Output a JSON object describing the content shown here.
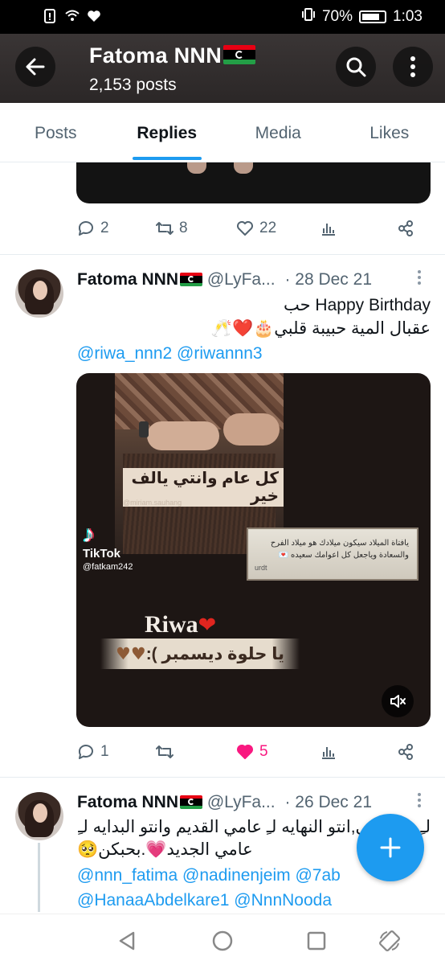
{
  "status_bar": {
    "battery": "70%",
    "time": "1:03"
  },
  "header": {
    "name": "Fatoma NNN",
    "posts": "2,153 posts"
  },
  "tabs": [
    {
      "label": "Posts"
    },
    {
      "label": "Replies",
      "active": true
    },
    {
      "label": "Media"
    },
    {
      "label": "Likes"
    }
  ],
  "tweet1": {
    "replies": "2",
    "retweets": "8",
    "likes": "22"
  },
  "tweet2": {
    "name": "Fatoma NNN",
    "handle": "@LyFa...",
    "date": "· 28 Dec 21",
    "line1": "Happy Birthday حب",
    "line2": "عقبال المية حبيبة قلبي🎂❤️🥂",
    "mentions": "@riwa_nnn2 @riwannn3",
    "media": {
      "caption_top": "كل عام وانتي يالف خير",
      "caption_small": "@miriam.sauhang",
      "note_text": "يافتاة الميلاد سيكون ميلادك هو ميلاد الفرح والسعادة وياجعل كل اعوامك سعيده 💌",
      "note_sig": "urdt",
      "tiktok_brand": "TikTok",
      "tiktok_user": "@fatkam242",
      "title": "Riwa",
      "ribbon": "يا حلوة ديسمبر ):"
    },
    "replies": "1",
    "retweets": "",
    "likes": "5",
    "colors": {
      "liked": "#f91880"
    }
  },
  "tweet3": {
    "name": "Fatoma NNN",
    "handle": "@LyFa...",
    "date": "· 26 Dec 21",
    "line1": "لـِ صديقاتي,انتو النهايه لـِ عامي القديم وانتو البدايه لـِ",
    "line2": "عامي الجديد💗.بحبكن🥺",
    "mentions1": "@nnn_fatima @nadinenjeim @7ab",
    "mentions2": "@HanaaAbdelkare1 @NnnNooda"
  },
  "colors": {
    "accent": "#1d9bf0",
    "muted": "#536471",
    "text": "#0f1419"
  }
}
